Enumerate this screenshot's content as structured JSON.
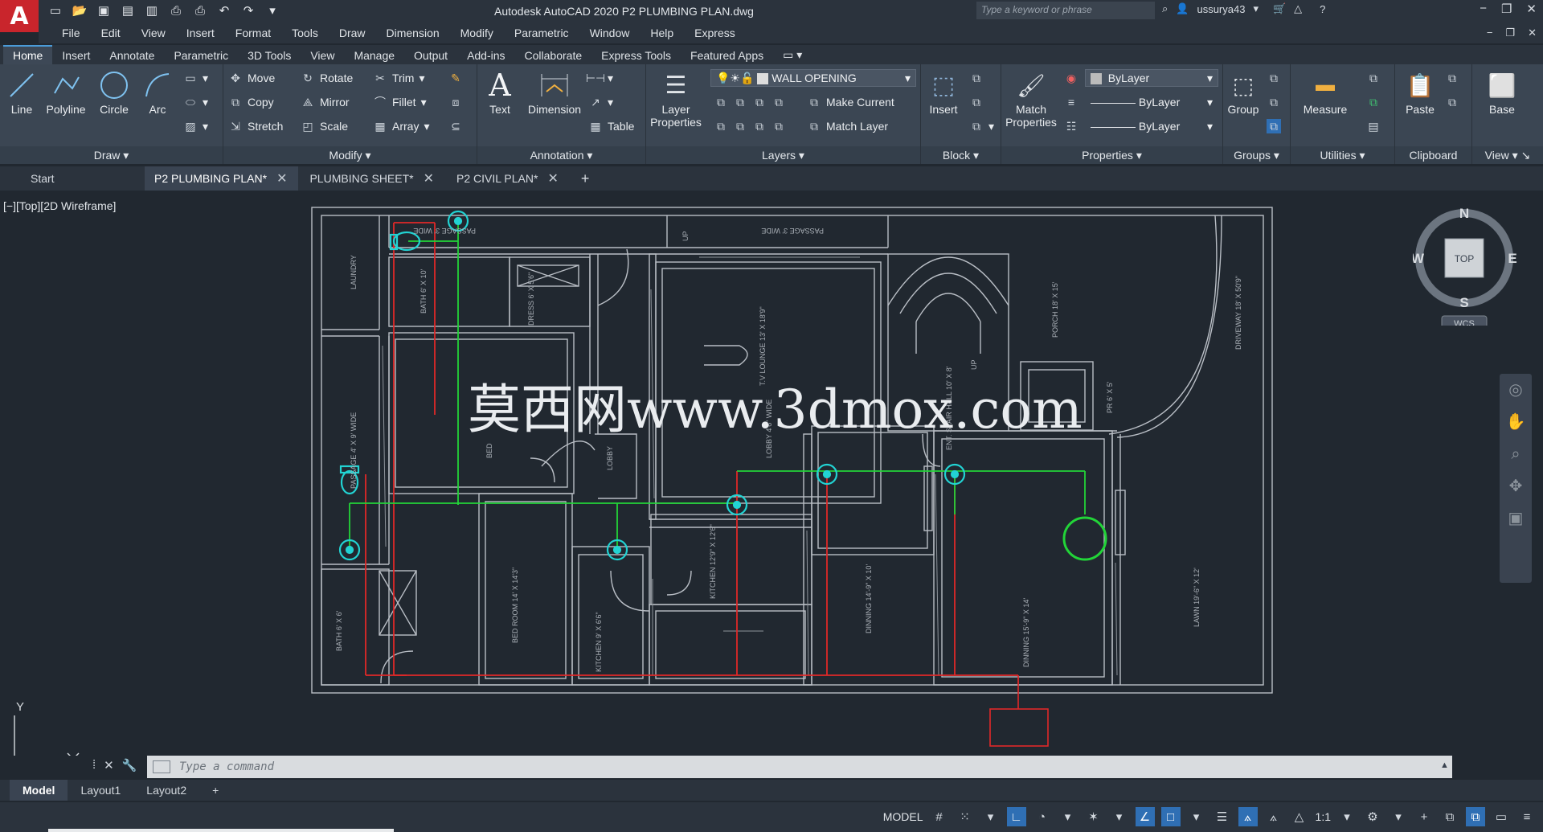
{
  "title_bar": {
    "logo": "A",
    "title": "Autodesk AutoCAD 2020    P2 PLUMBING PLAN.dwg",
    "search_placeholder": "Type a keyword or phrase",
    "user": "ussurya43"
  },
  "menu": [
    "File",
    "Edit",
    "View",
    "Insert",
    "Format",
    "Tools",
    "Draw",
    "Dimension",
    "Modify",
    "Parametric",
    "Window",
    "Help",
    "Express"
  ],
  "ribbon_tabs": [
    "Home",
    "Insert",
    "Annotate",
    "Parametric",
    "3D Tools",
    "View",
    "Manage",
    "Output",
    "Add-ins",
    "Collaborate",
    "Express Tools",
    "Featured Apps"
  ],
  "ribbon": {
    "draw": {
      "title": "Draw",
      "line": "Line",
      "polyline": "Polyline",
      "circle": "Circle",
      "arc": "Arc"
    },
    "modify": {
      "title": "Modify",
      "move": "Move",
      "rotate": "Rotate",
      "trim": "Trim",
      "copy": "Copy",
      "mirror": "Mirror",
      "fillet": "Fillet",
      "stretch": "Stretch",
      "scale": "Scale",
      "array": "Array"
    },
    "annotation": {
      "title": "Annotation",
      "text": "Text",
      "dimension": "Dimension",
      "table": "Table"
    },
    "layers": {
      "title": "Layers",
      "layer_properties": "Layer Properties",
      "current_layer": "WALL OPENING",
      "make_current": "Make Current",
      "match_layer": "Match Layer"
    },
    "block": {
      "title": "Block",
      "insert": "Insert"
    },
    "properties": {
      "title": "Properties",
      "match_properties": "Match Properties",
      "color": "ByLayer",
      "linetype": "ByLayer",
      "lineweight": "ByLayer"
    },
    "groups": {
      "title": "Groups",
      "group": "Group"
    },
    "utilities": {
      "title": "Utilities",
      "measure": "Measure"
    },
    "clipboard": {
      "title": "Clipboard",
      "paste": "Paste"
    },
    "view": {
      "title": "View",
      "base": "Base"
    }
  },
  "doc_tabs": [
    "Start",
    "P2 PLUMBING PLAN*",
    "PLUMBING SHEET*",
    "P2 CIVIL PLAN*"
  ],
  "viewport_label": "[−][Top][2D Wireframe]",
  "drawing_labels": {
    "passage_top1": "PASSAGE 3' WIDE",
    "passage_top2": "PASSAGE 3' WIDE",
    "up1": "UP",
    "laundry": "LAUNDRY",
    "bath1": "BATH 6' X 10'",
    "dress": "DRESS 6' X 5'6\"",
    "passage_left": "PASSAGE 4' X 9' WIDE",
    "bed1": "BED",
    "lobby": "LOBBY",
    "tv_lounge": "T.V LOUNGE 13' X 18'9\"",
    "lobby2": "LOBBY 4'6\" WIDE",
    "ent_stair_hall": "ENT. STAIR HALL 10' X 8'",
    "up2": "UP",
    "porch": "PORCH 18' X 15'",
    "driveway": "DRIVEWAY 18' X 50'9\"",
    "pr": "PR 6' X 5'",
    "kitchen": "KITCHEN 12'9\" X 12'6\"",
    "dinning1": "DINNING 14'-9\" X 10'",
    "dinning2": "DINNING 15'-9\" X 14'",
    "lawn": "LAWN 19'-6\" X 12'",
    "bed_room": "BED ROOM 14' X 14'3\"",
    "bath2": "BATH 6' X 6'",
    "kitchen2": "KITCHEN 9' X 6'6\""
  },
  "watermark": "莫西网www.3dmox.com",
  "viewcube": {
    "n": "N",
    "s": "S",
    "e": "E",
    "w": "W",
    "top": "TOP",
    "wcs": "WCS"
  },
  "ucs": {
    "y": "Y"
  },
  "command_placeholder": "Type a command",
  "layout_tabs": [
    "Model",
    "Layout1",
    "Layout2"
  ],
  "status": {
    "model": "MODEL",
    "scale": "1:1"
  },
  "colors": {
    "background": "#212830",
    "pipe_green": "#22d438",
    "pipe_red": "#e02828",
    "fixture_cyan": "#22d3d3",
    "wall": "#b9bec5"
  }
}
